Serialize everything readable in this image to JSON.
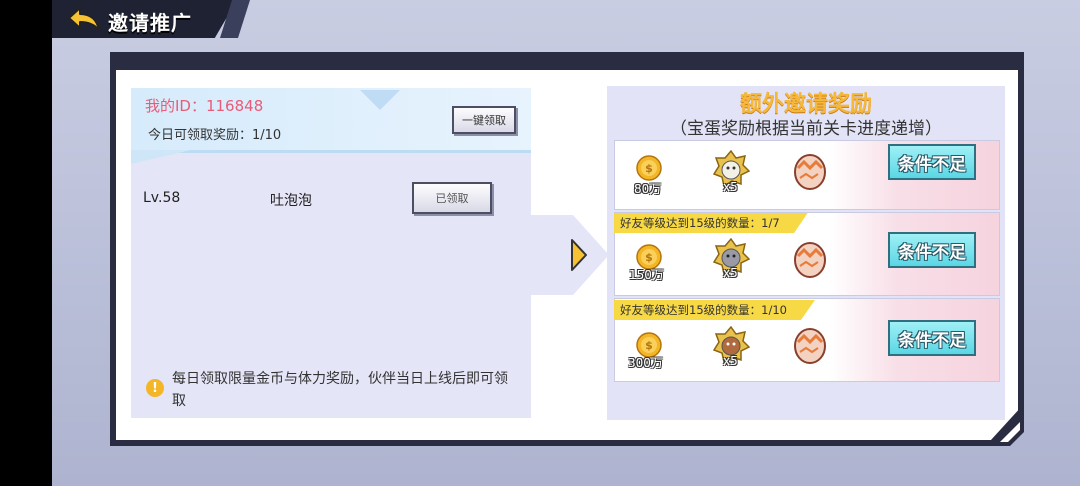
{
  "header": {
    "title": "邀请推广"
  },
  "left_panel": {
    "my_id": "我的ID：116848",
    "today_claim": "今日可领取奖励：1/10",
    "claim_all_label": "一键领取",
    "friends": [
      {
        "level": "Lv.58",
        "name": "吐泡泡",
        "button_label": "已领取"
      }
    ],
    "notice": "每日领取限量金币与体力奖励，伙伴当日上线后即可领取"
  },
  "right_panel": {
    "title": "额外邀请奖励",
    "subtitle": "（宝蛋奖励根据当前关卡进度递增）",
    "rewards": [
      {
        "condition": "",
        "coins": "80万",
        "badge_count": "x5",
        "button_label": "条件不足"
      },
      {
        "condition": "好友等级达到15级的数量：1/7",
        "coins": "150万",
        "badge_count": "x5",
        "button_label": "条件不足"
      },
      {
        "condition": "好友等级达到15级的数量：1/10",
        "coins": "300万",
        "badge_count": "x5",
        "button_label": "条件不足"
      }
    ]
  },
  "colors": {
    "id_pink": "#ea5b78",
    "title_gold": "#f5b83a",
    "condition_yellow": "#f7d845",
    "button_cyan": "#5bd6e4"
  },
  "icons": [
    "back-arrow-icon",
    "info-icon",
    "arrow-right-icon",
    "coin-icon",
    "badge-icon",
    "egg-icon"
  ]
}
